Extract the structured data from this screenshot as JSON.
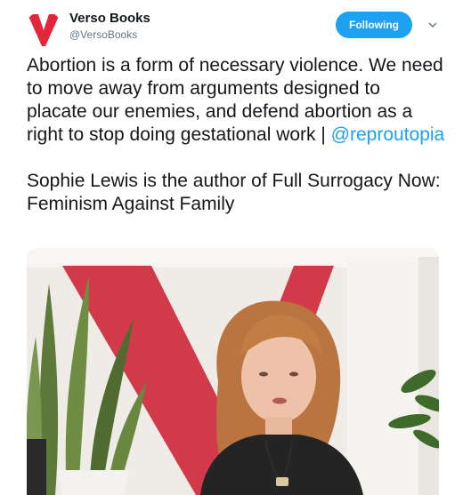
{
  "account": {
    "display_name": "Verso Books",
    "handle": "@VersoBooks",
    "avatar_icon": "verso-v-logo",
    "brand_color": "#e3263a"
  },
  "follow": {
    "label": "Following",
    "color": "#1da1f2"
  },
  "menu": {
    "icon": "chevron-down-icon"
  },
  "tweet": {
    "paragraph1_text": "Abortion is a form of necessary violence. We need to move away from arguments designed to placate our enemies, and defend abortion as a right to stop doing gestational work | ",
    "mention": "@reproutopia",
    "paragraph2_text": "Sophie Lewis is the author of Full Surrogacy Now: Feminism Against Family"
  },
  "media": {
    "type": "video-thumbnail"
  }
}
